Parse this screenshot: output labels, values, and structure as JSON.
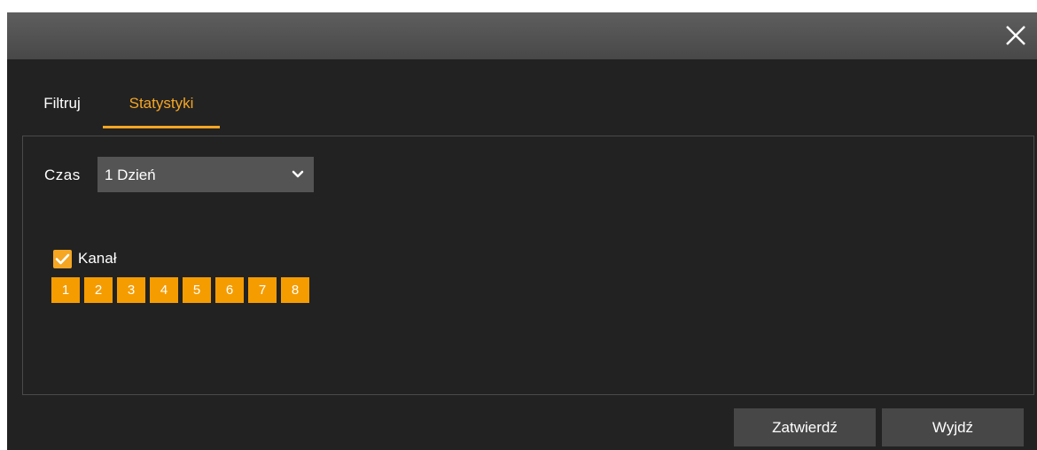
{
  "dialog": {
    "close_icon": "close-icon"
  },
  "tabs": [
    {
      "label": "Filtruj",
      "active": false
    },
    {
      "label": "Statystyki",
      "active": true
    }
  ],
  "form": {
    "time_label": "Czas",
    "time_value": "1 Dzień",
    "channel_label": "Kanał",
    "channel_checked": true,
    "channels": [
      "1",
      "2",
      "3",
      "4",
      "5",
      "6",
      "7",
      "8"
    ]
  },
  "buttons": {
    "confirm": "Zatwierdź",
    "exit": "Wyjdź"
  },
  "colors": {
    "accent": "#f5a623",
    "channel_bg": "#f59c00",
    "dialog_bg": "#222222",
    "titlebar": "#555555",
    "button_bg": "#474747"
  }
}
